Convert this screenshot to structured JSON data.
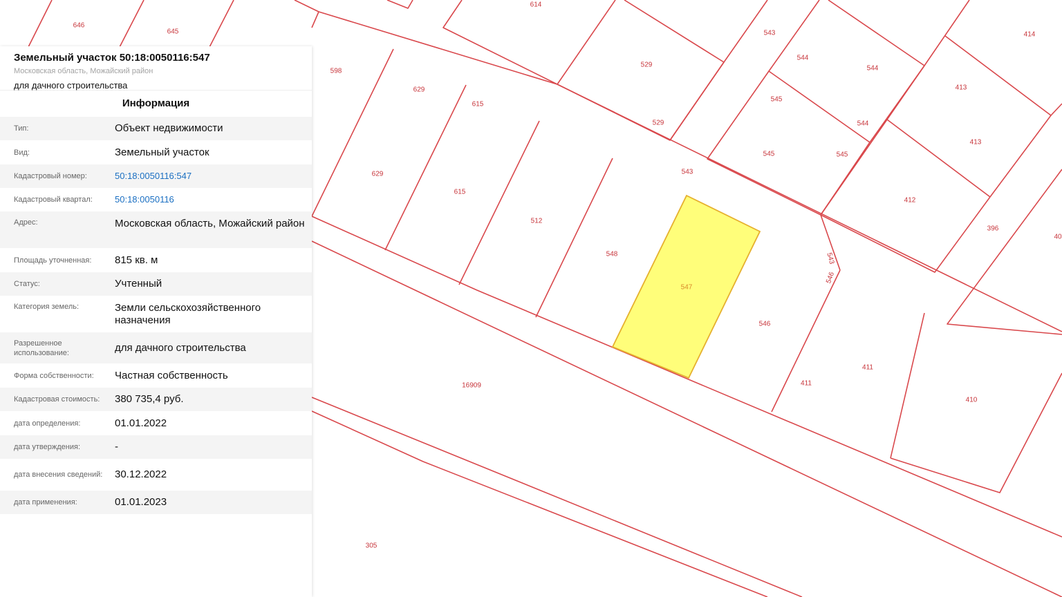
{
  "panel": {
    "title": "Земельный участок 50:18:0050116:547",
    "address": "Московская область, Можайский район",
    "use": "для дачного строительства",
    "section_title": "Информация",
    "rows": [
      {
        "key": "Тип:",
        "value": "Объект недвижимости"
      },
      {
        "key": "Вид:",
        "value": "Земельный участок"
      },
      {
        "key": "Кадастровый номер:",
        "value": "50:18:0050116:547",
        "link": true
      },
      {
        "key": "Кадастровый квартал:",
        "value": "50:18:0050116",
        "link": true
      },
      {
        "key": "Адрес:",
        "value": "Московская область, Можайский район"
      },
      {
        "key": "Площадь уточненная:",
        "value": "815 кв. м"
      },
      {
        "key": "Статус:",
        "value": "Учтенный"
      },
      {
        "key": "Категория земель:",
        "value": "Земли сельскохозяйственного назначения"
      },
      {
        "key": "Разрешенное использование:",
        "value": "для дачного строительства"
      },
      {
        "key": "Форма собственности:",
        "value": "Частная собственность"
      },
      {
        "key": "Кадастровая стоимость:",
        "value": "380 735,4 руб."
      },
      {
        "key": "дата определения:",
        "value": "01.01.2022"
      },
      {
        "key": "дата утверждения:",
        "value": "-"
      },
      {
        "key": "дата внесения сведений:",
        "value": "30.12.2022"
      },
      {
        "key": "дата применения:",
        "value": "01.01.2023"
      }
    ]
  },
  "map": {
    "selected_parcel": "547",
    "colors": {
      "boundary": "#d9484c",
      "selected_fill": "#fffe7a",
      "selected_outline": "#e6b02e",
      "label": "#c7343a"
    },
    "labels": [
      "646",
      "645",
      "614",
      "543",
      "414",
      "598",
      "629",
      "615",
      "529",
      "544",
      "413",
      "545",
      "412",
      "396",
      "40",
      "512",
      "548",
      "547",
      "546",
      "411",
      "410",
      "16909",
      "305"
    ]
  }
}
